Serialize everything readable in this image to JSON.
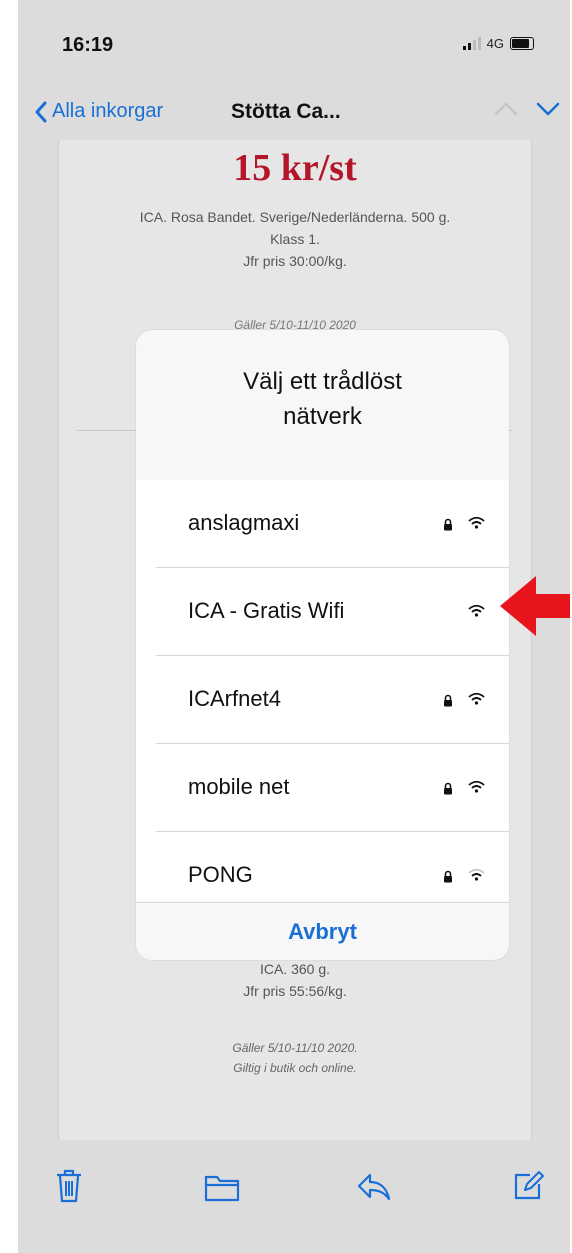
{
  "status_bar": {
    "time": "16:19",
    "network": "4G"
  },
  "nav": {
    "back_label": "Alla inkorgar",
    "subject": "Stötta Ca..."
  },
  "email": {
    "price": "15 kr/st",
    "product_lines": [
      "ICA. Rosa Bandet. Sverige/Nederländerna. 500 g.",
      "Klass 1.",
      "Jfr pris 30:00/kg."
    ],
    "valid_partial": "Gäller 5/10-11/10 2020",
    "lower_lines": [
      "ICA. 360 g.",
      "Jfr pris 55:56/kg."
    ],
    "valid_lines": [
      "Gäller 5/10-11/10 2020.",
      "Giltig i butik och online."
    ]
  },
  "wifi_dialog": {
    "title_line1": "Välj ett trådlöst",
    "title_line2": "nätverk",
    "networks": [
      {
        "name": "anslagmaxi",
        "locked": true,
        "signal": "full"
      },
      {
        "name": "ICA - Gratis Wifi",
        "locked": false,
        "signal": "full"
      },
      {
        "name": "ICArfnet4",
        "locked": true,
        "signal": "full"
      },
      {
        "name": "mobile net",
        "locked": true,
        "signal": "full"
      },
      {
        "name": "PONG",
        "locked": true,
        "signal": "weak"
      }
    ],
    "cancel_label": "Avbryt"
  },
  "toolbar": {
    "icons": [
      "trash-icon",
      "folder-icon",
      "reply-icon",
      "compose-icon"
    ]
  },
  "colors": {
    "accent": "#1a6fd6",
    "price_red": "#b51528",
    "annotation_arrow": "#e8141c"
  }
}
